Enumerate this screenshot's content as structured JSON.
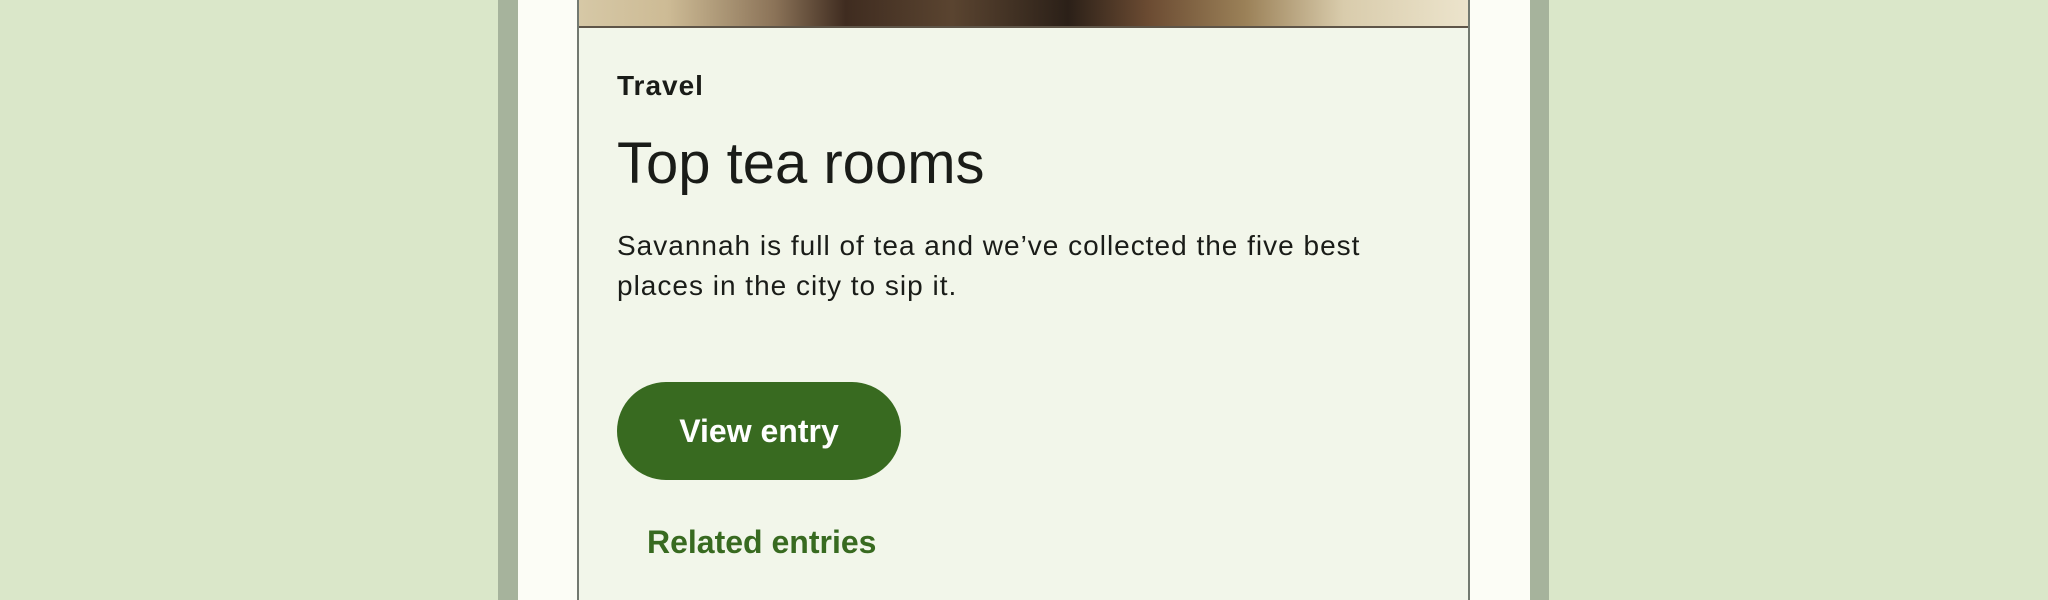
{
  "card": {
    "overline": "Travel",
    "title": "Top tea rooms",
    "description": "Savannah is full of tea and we’ve collected the five best places in the city to sip it.",
    "primary_action": "View entry",
    "secondary_action": "Related entries"
  },
  "colors": {
    "background": "#dae7c9",
    "frame": "#a6b39c",
    "surface": "#fcfdf6",
    "card": "#f2f6ea",
    "primary": "#386a20",
    "on_surface": "#1a1c18"
  }
}
